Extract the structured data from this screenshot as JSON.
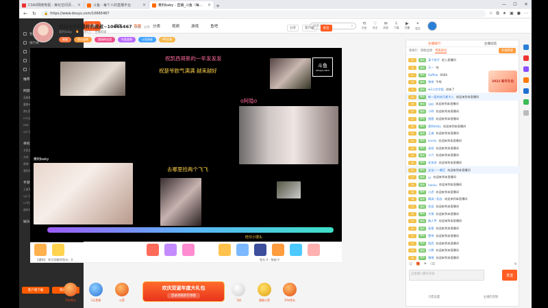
{
  "browser": {
    "tabs": [
      {
        "label": "CSWI网络电视 - 美化空间页面版",
        "active": false
      },
      {
        "label": "斗鱼 - 每个人的直播平台",
        "active": false
      },
      {
        "label": "奥利baby - 直播_斗鱼（每个人",
        "active": true
      }
    ],
    "url": "https://www.douyu.com/10665467",
    "new_tab": "+"
  },
  "sidebar": {
    "items": [
      "我的关注",
      "排行榜",
      "页游中心",
      "云游戏",
      "赛事"
    ],
    "sections": [
      {
        "title": "推荐分类",
        "more": "更多",
        "games": []
      },
      {
        "title": "网游竞技",
        "more": "更多",
        "games": [
          "英雄联盟",
          "穿越火线",
          "DOTA2",
          "魔兽RPG",
          "绝地求生",
          "CF",
          "梦幻西游",
          "CSGO",
          "逆战",
          "LOL云顶之弈",
          "炉石传说",
          "魔兽世界",
          "DNF",
          "主机游戏",
          "DOTA",
          "QQ飞车",
          "永劫无间",
          "APEX"
        ]
      },
      {
        "title": "单机热游",
        "more": "更多",
        "games": [
          "主机游戏",
          "永劫无间",
          "使命召唤",
          "方舟",
          "艾尔登法环",
          "怪物猎人",
          "原神",
          "星际争霸",
          "单机游戏",
          "我的世界",
          "战地",
          "帝国时代"
        ]
      },
      {
        "title": "手游休闲",
        "more": "更多",
        "games": [
          "王者荣耀",
          "和平精英",
          "火影忍者",
          "QQ飞车",
          "金铲铲",
          "第五人格",
          "CF手游",
          "跑跑卡丁车",
          "狼人杀",
          "使命召唤",
          "王牌战士",
          "阴阳师"
        ]
      },
      {
        "title": "娱乐天地",
        "more": "更多",
        "games": []
      }
    ],
    "bottom_buttons": [
      "客户端下载",
      "我的主页"
    ]
  },
  "topnav": {
    "logo": "斗鱼",
    "links": [
      "首页",
      "直播",
      "分类",
      "视频",
      "游戏",
      "鱼吧"
    ],
    "active": "直播",
    "search_placeholder": "搜索主播",
    "icons": [
      {
        "icon": "history-icon",
        "label": "历史"
      },
      {
        "icon": "follow-icon",
        "label": "关注"
      },
      {
        "icon": "message-icon",
        "label": "消息"
      },
      {
        "icon": "download-icon",
        "label": "下载"
      },
      {
        "icon": "live-icon",
        "label": "开播"
      },
      {
        "icon": "location-icon",
        "label": "定位"
      }
    ]
  },
  "room": {
    "title": "感谢全世界最好的叔叔~10665467",
    "title_sub": "举报 · 分享",
    "meta": [
      "奥利baby",
      "597万",
      "主播等级"
    ],
    "badges": [
      {
        "label": "贵族",
        "color": "#ff7a45"
      },
      {
        "label": "鱼乐盛典",
        "color": "#ff9d3d"
      },
      {
        "label": "超级粉丝团",
        "color": "#f04d8b"
      },
      {
        "label": "年度盛典",
        "color": "#b86bff"
      },
      {
        "label": "斗鱼周星",
        "color": "#41a3ff"
      },
      {
        "label": "MR奖章",
        "color": "#f5b84b"
      }
    ],
    "actions": [
      "分享",
      "客户端",
      "关注"
    ]
  },
  "video": {
    "line1": "祝凯西哥新的一年发发发",
    "line2": "祝楚爷欧气满满 越来越好",
    "line3": "去哪里捡两个飞飞",
    "top_right_name": "o阿隐o",
    "watermark": "斗鱼",
    "watermark_sub": "douyu.com",
    "left_tag": "奥利baby",
    "bottom_tag": "旺仔小馒头"
  },
  "giftbar": {
    "info_line": "【通知】 你可用剩余鱼丸：0",
    "counts": "鱼丸 0 · 鱼翅 0"
  },
  "banner": {
    "title": "欢庆双诞年度大礼包",
    "sub": "登录领取即可领取",
    "gifts": [
      "10w鱼丸",
      "1元鱼翅",
      "火箭",
      "飞机",
      "超级火箭",
      "10w鱼丸"
    ]
  },
  "chat": {
    "top_tabs": [
      "主播排行",
      "主播动态"
    ],
    "sub_tabs": [
      "周排行",
      "周粉丝榜",
      "贵族席位"
    ],
    "open_btn": "开通贵族",
    "promo": "2022 新年礼包",
    "messages": [
      {
        "level": "32",
        "fan": "奥利",
        "user": "某个孩子",
        "text": "进入直播间"
      },
      {
        "level": "16",
        "fan": "奥利",
        "user": "天一",
        "text": "哈"
      },
      {
        "level": "21",
        "fan": "奥利",
        "user": "Soffiao",
        "text": "6666"
      },
      {
        "level": "25",
        "fan": "奥利",
        "user": "独卷",
        "text": "牛呀"
      },
      {
        "level": "9",
        "fan": "奥利",
        "user": "w2小艾学姐",
        "text": "进来了"
      },
      {
        "level": "44",
        "fan": "奥利",
        "user": "新一届的欢乐都大人",
        "text": "欢迎来到本直播间",
        "highlight": true
      },
      {
        "level": "18",
        "fan": "奥利",
        "user": "100",
        "text": "欢迎来到本直播间"
      },
      {
        "level": "12",
        "fan": "奥利",
        "user": "小明",
        "text": "欢迎来到本直播间"
      },
      {
        "level": "27",
        "fan": "奥利",
        "user": "甜甜",
        "text": "欢迎来到本直播间"
      },
      {
        "level": "35",
        "fan": "奥利",
        "user": "奥利baby",
        "text": "欢迎来到本直播间"
      },
      {
        "level": "20",
        "fan": "奥利",
        "user": "王者",
        "text": "欢迎来到本直播间"
      },
      {
        "level": "15",
        "fan": "奥利",
        "user": "lovely",
        "text": "欢迎来到本直播间"
      },
      {
        "level": "23",
        "fan": "奥利",
        "user": "叔叔",
        "text": "欢迎来到本直播间"
      },
      {
        "level": "19",
        "fan": "奥利",
        "user": "小六",
        "text": "欢迎来到本直播间"
      },
      {
        "level": "30",
        "fan": "奥利",
        "user": "发发发",
        "text": "欢迎来到本直播间"
      },
      {
        "level": "22",
        "fan": "奥利",
        "user": "宝宝一一最后",
        "text": "欢迎来到本直播间",
        "highlight": true
      },
      {
        "level": "17",
        "fan": "奥利",
        "user": "ss",
        "text": "欢迎来到本直播间"
      },
      {
        "level": "24",
        "fan": "奥利",
        "user": "hololu",
        "text": "欢迎来到本直播间"
      },
      {
        "level": "26",
        "fan": "奥利",
        "user": "小虎",
        "text": "欢迎来到本直播间"
      },
      {
        "level": "28",
        "fan": "奥利",
        "user": "精英一起去",
        "text": "欢迎来到本直播间"
      },
      {
        "level": "14",
        "fan": "奥利",
        "user": "欢迎",
        "text": "欢迎来到本直播间"
      },
      {
        "level": "33",
        "fan": "奥利",
        "user": "大哥",
        "text": "欢迎来到本直播间"
      },
      {
        "level": "11",
        "fan": "奥利",
        "user": "路人甲",
        "text": "欢迎来到本直播间"
      },
      {
        "level": "29",
        "fan": "奥利",
        "user": "星星",
        "text": "欢迎来到本直播间"
      },
      {
        "level": "31",
        "fan": "奥利",
        "user": "楚爷",
        "text": "欢迎来到本直播间"
      },
      {
        "level": "13",
        "fan": "奥利",
        "user": "凯西",
        "text": "欢迎来到本直播间"
      },
      {
        "level": "10",
        "fan": "奥利",
        "user": "小熊",
        "text": "欢迎来到本直播间"
      },
      {
        "level": "36",
        "fan": "奥利",
        "user": "嘿嘿",
        "text": "欢迎来到本直播间"
      }
    ],
    "input_placeholder": "这里输入聊天内容",
    "send_label": "发送",
    "bottom": [
      "习惯设置",
      "主播的宠物"
    ]
  },
  "window": {
    "minimize": "—",
    "maximize": "☐",
    "close": "✕"
  }
}
